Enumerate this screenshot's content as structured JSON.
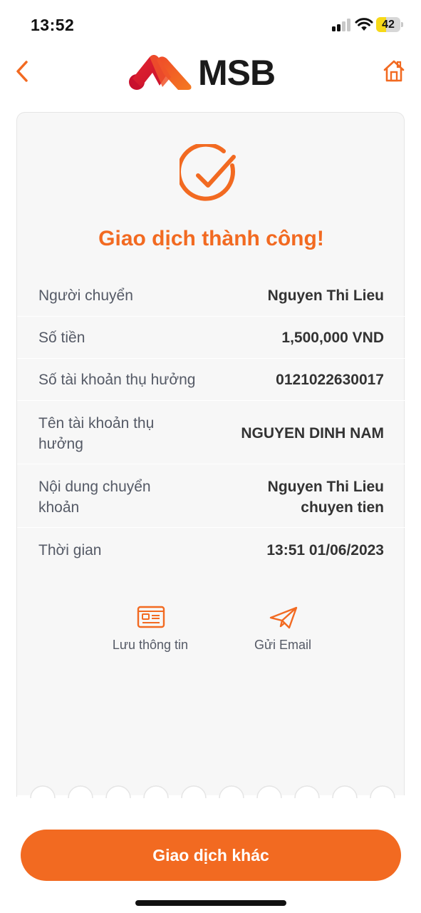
{
  "status_bar": {
    "time": "13:52",
    "battery_level": "42",
    "battery_fraction": 0.42,
    "signal_bars_active": 2,
    "signal_bars_total": 4
  },
  "header": {
    "brand": "MSB",
    "back_icon": "chevron-left-icon",
    "home_icon": "home-icon"
  },
  "receipt": {
    "title": "Giao dịch thành công!",
    "status_icon": "check-circle-icon",
    "rows": [
      {
        "label": "Người chuyển",
        "value": "Nguyen Thi Lieu"
      },
      {
        "label": "Số tiền",
        "value": "1,500,000 VND"
      },
      {
        "label": "Số tài khoản thụ hưởng",
        "value": "0121022630017"
      },
      {
        "label": "Tên tài khoản thụ hưởng",
        "value": "NGUYEN DINH NAM"
      },
      {
        "label": "Nội dung chuyển khoản",
        "value": "Nguyen Thi Lieu chuyen tien"
      },
      {
        "label": "Thời gian",
        "value": "13:51 01/06/2023"
      }
    ],
    "actions": [
      {
        "label": "Lưu thông tin",
        "icon": "id-card-icon"
      },
      {
        "label": "Gửi Email",
        "icon": "paper-plane-icon"
      }
    ]
  },
  "footer": {
    "primary_button": "Giao dịch khác"
  },
  "colors": {
    "accent": "#f26a21",
    "card_background": "#f7f7f7",
    "label_text": "#555a66",
    "value_text": "#333333"
  }
}
